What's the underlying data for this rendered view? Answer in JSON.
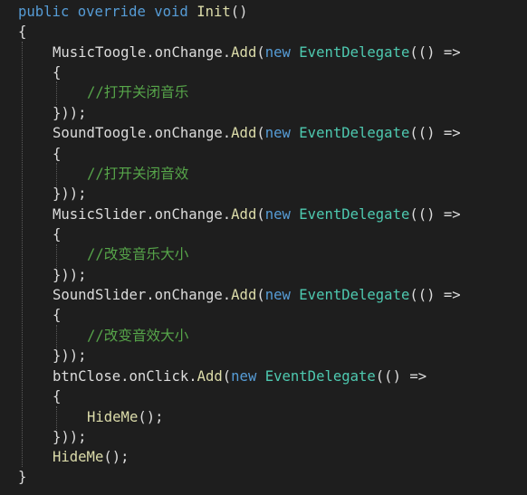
{
  "colors": {
    "background": "#1e1e1e",
    "keyword": "#569cd6",
    "identifier": "#dcdcdc",
    "method": "#dcdcaa",
    "type": "#4ec9b0",
    "comment": "#57a64a",
    "indent_guide": "#5a5a5a"
  },
  "code": {
    "signature": {
      "kw_public": "public",
      "kw_override": "override",
      "kw_void": "void",
      "method": "Init",
      "parens": "()"
    },
    "open_brace": "{",
    "close_brace": "}",
    "blocks": [
      {
        "target": "MusicToogle",
        "dot_event": ".onChange.",
        "add": "Add",
        "paren_open": "(",
        "kw_new": "new",
        "delegate": "EventDelegate",
        "lambda": "(() =>",
        "brace_open": "{",
        "comment": "//打开关闭音乐",
        "closer": "}));"
      },
      {
        "target": "SoundToogle",
        "dot_event": ".onChange.",
        "add": "Add",
        "paren_open": "(",
        "kw_new": "new",
        "delegate": "EventDelegate",
        "lambda": "(() =>",
        "brace_open": "{",
        "comment": "//打开关闭音效",
        "closer": "}));"
      },
      {
        "target": "MusicSlider",
        "dot_event": ".onChange.",
        "add": "Add",
        "paren_open": "(",
        "kw_new": "new",
        "delegate": "EventDelegate",
        "lambda": "(() =>",
        "brace_open": "{",
        "comment": "//改变音乐大小",
        "closer": "}));"
      },
      {
        "target": "SoundSlider",
        "dot_event": ".onChange.",
        "add": "Add",
        "paren_open": "(",
        "kw_new": "new",
        "delegate": "EventDelegate",
        "lambda": "(() =>",
        "brace_open": "{",
        "comment": "//改变音效大小",
        "closer": "}));"
      },
      {
        "target": "btnClose",
        "dot_event": ".onClick.",
        "add": "Add",
        "paren_open": "(",
        "kw_new": "new",
        "delegate": "EventDelegate",
        "lambda": "(() =>",
        "brace_open": "{",
        "call_method": "HideMe",
        "call_suffix": "();",
        "closer": "}));"
      }
    ],
    "final_call": {
      "method": "HideMe",
      "suffix": "();"
    }
  }
}
